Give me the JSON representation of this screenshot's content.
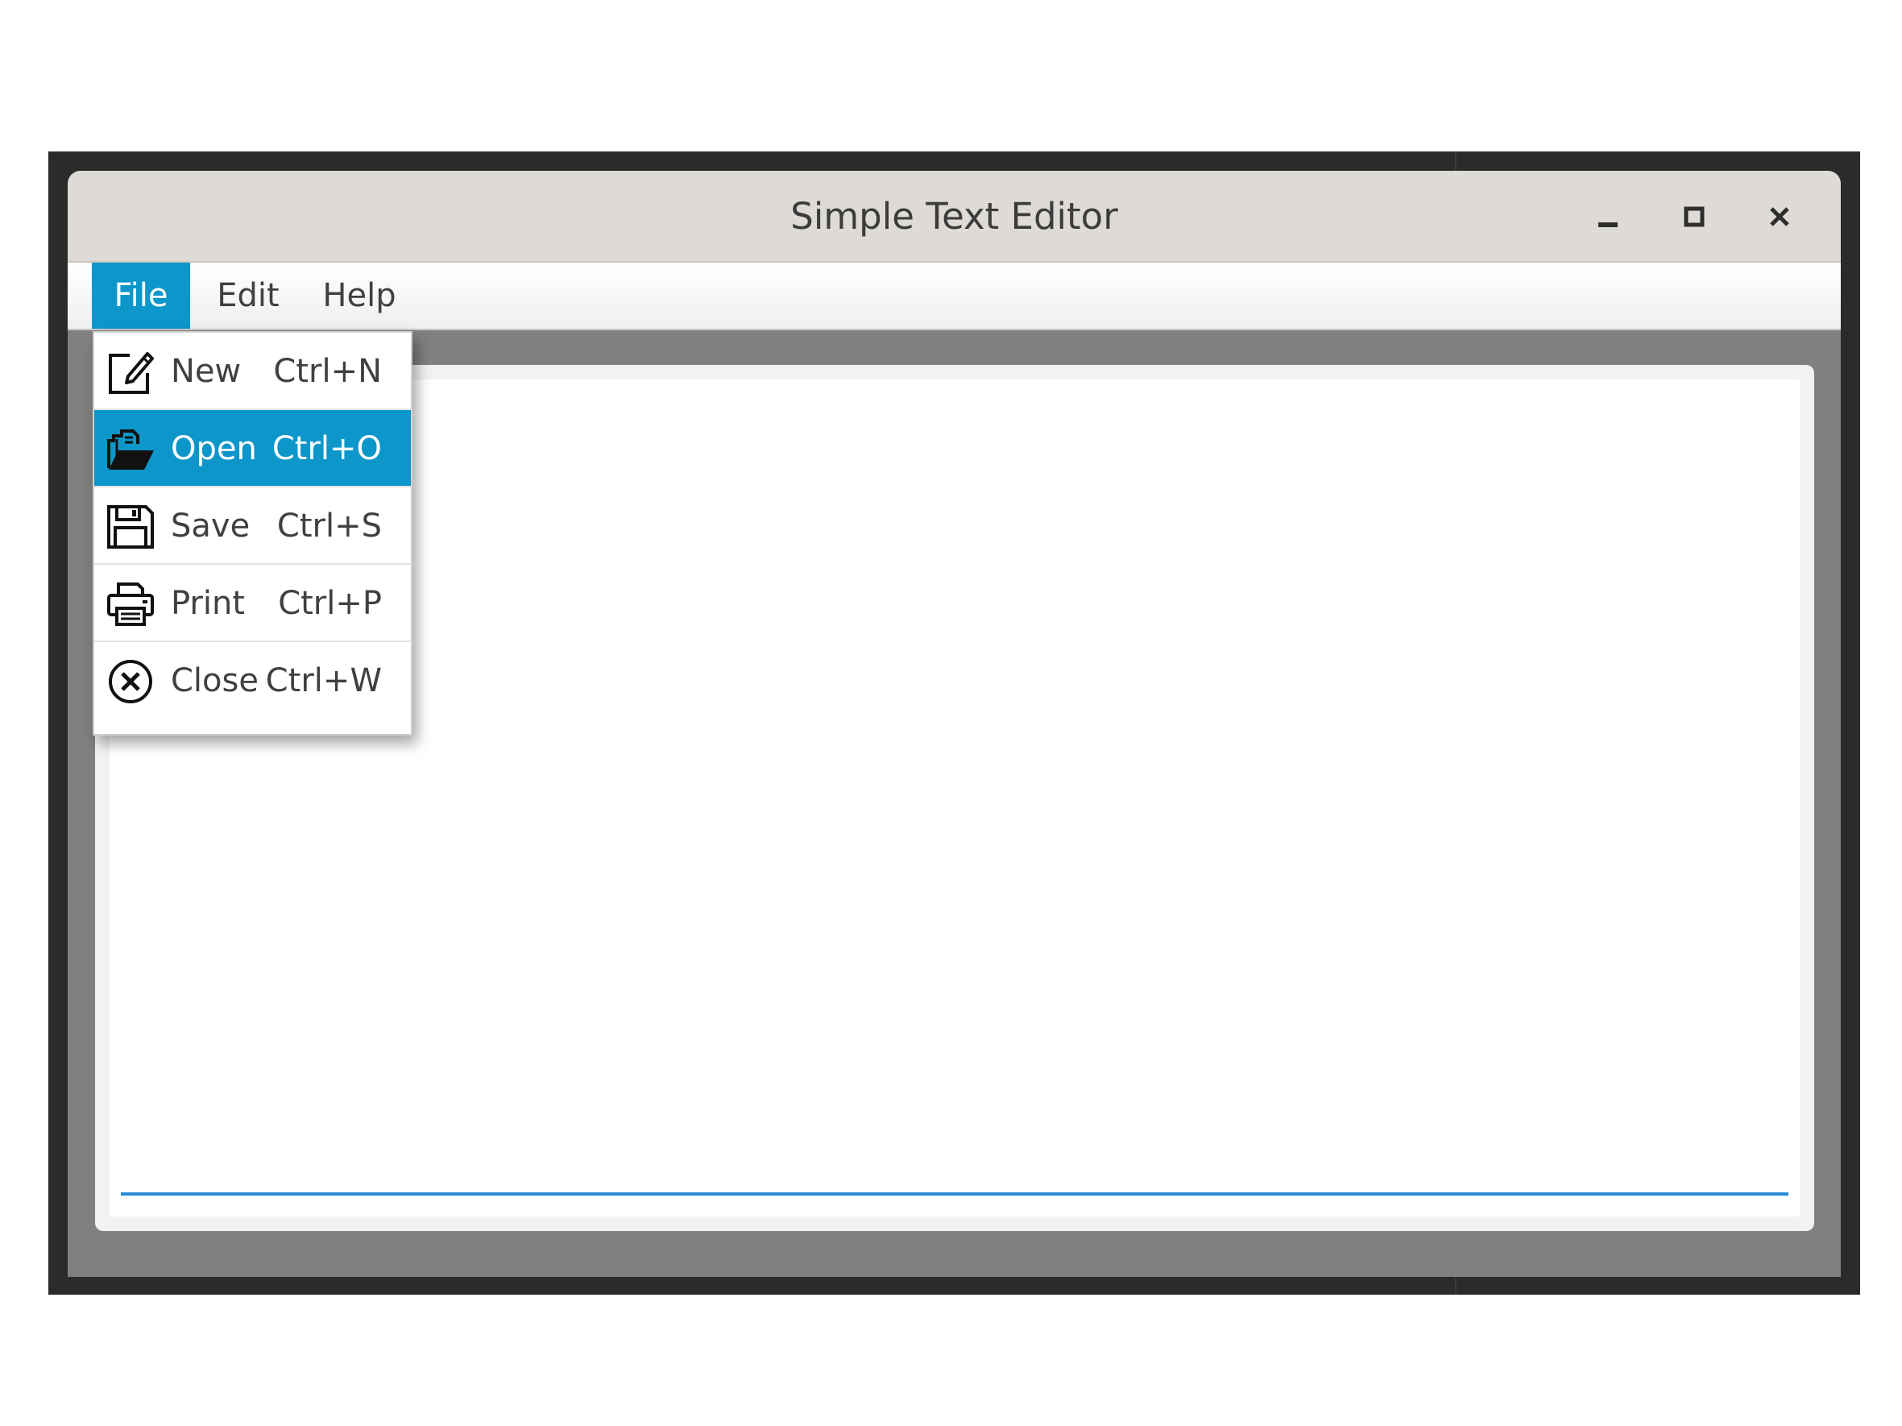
{
  "window": {
    "title": "Simple Text Editor"
  },
  "menubar": {
    "items": [
      {
        "label": "File",
        "active": true
      },
      {
        "label": "Edit",
        "active": false
      },
      {
        "label": "Help",
        "active": false
      }
    ]
  },
  "file_menu": {
    "items": [
      {
        "label": "New",
        "shortcut": "Ctrl+N",
        "icon": "new-document-icon",
        "highlighted": false
      },
      {
        "label": "Open",
        "shortcut": "Ctrl+O",
        "icon": "open-folder-icon",
        "highlighted": true
      },
      {
        "label": "Save",
        "shortcut": "Ctrl+S",
        "icon": "floppy-disk-icon",
        "highlighted": false
      },
      {
        "label": "Print",
        "shortcut": "Ctrl+P",
        "icon": "printer-icon",
        "highlighted": false
      },
      {
        "label": "Close",
        "shortcut": "Ctrl+W",
        "icon": "close-circle-icon",
        "highlighted": false
      }
    ]
  },
  "colors": {
    "accent": "#0d96c9",
    "focus_line": "#2a8ad6",
    "titlebar": "#dedbd7",
    "window_body": "#808080"
  }
}
